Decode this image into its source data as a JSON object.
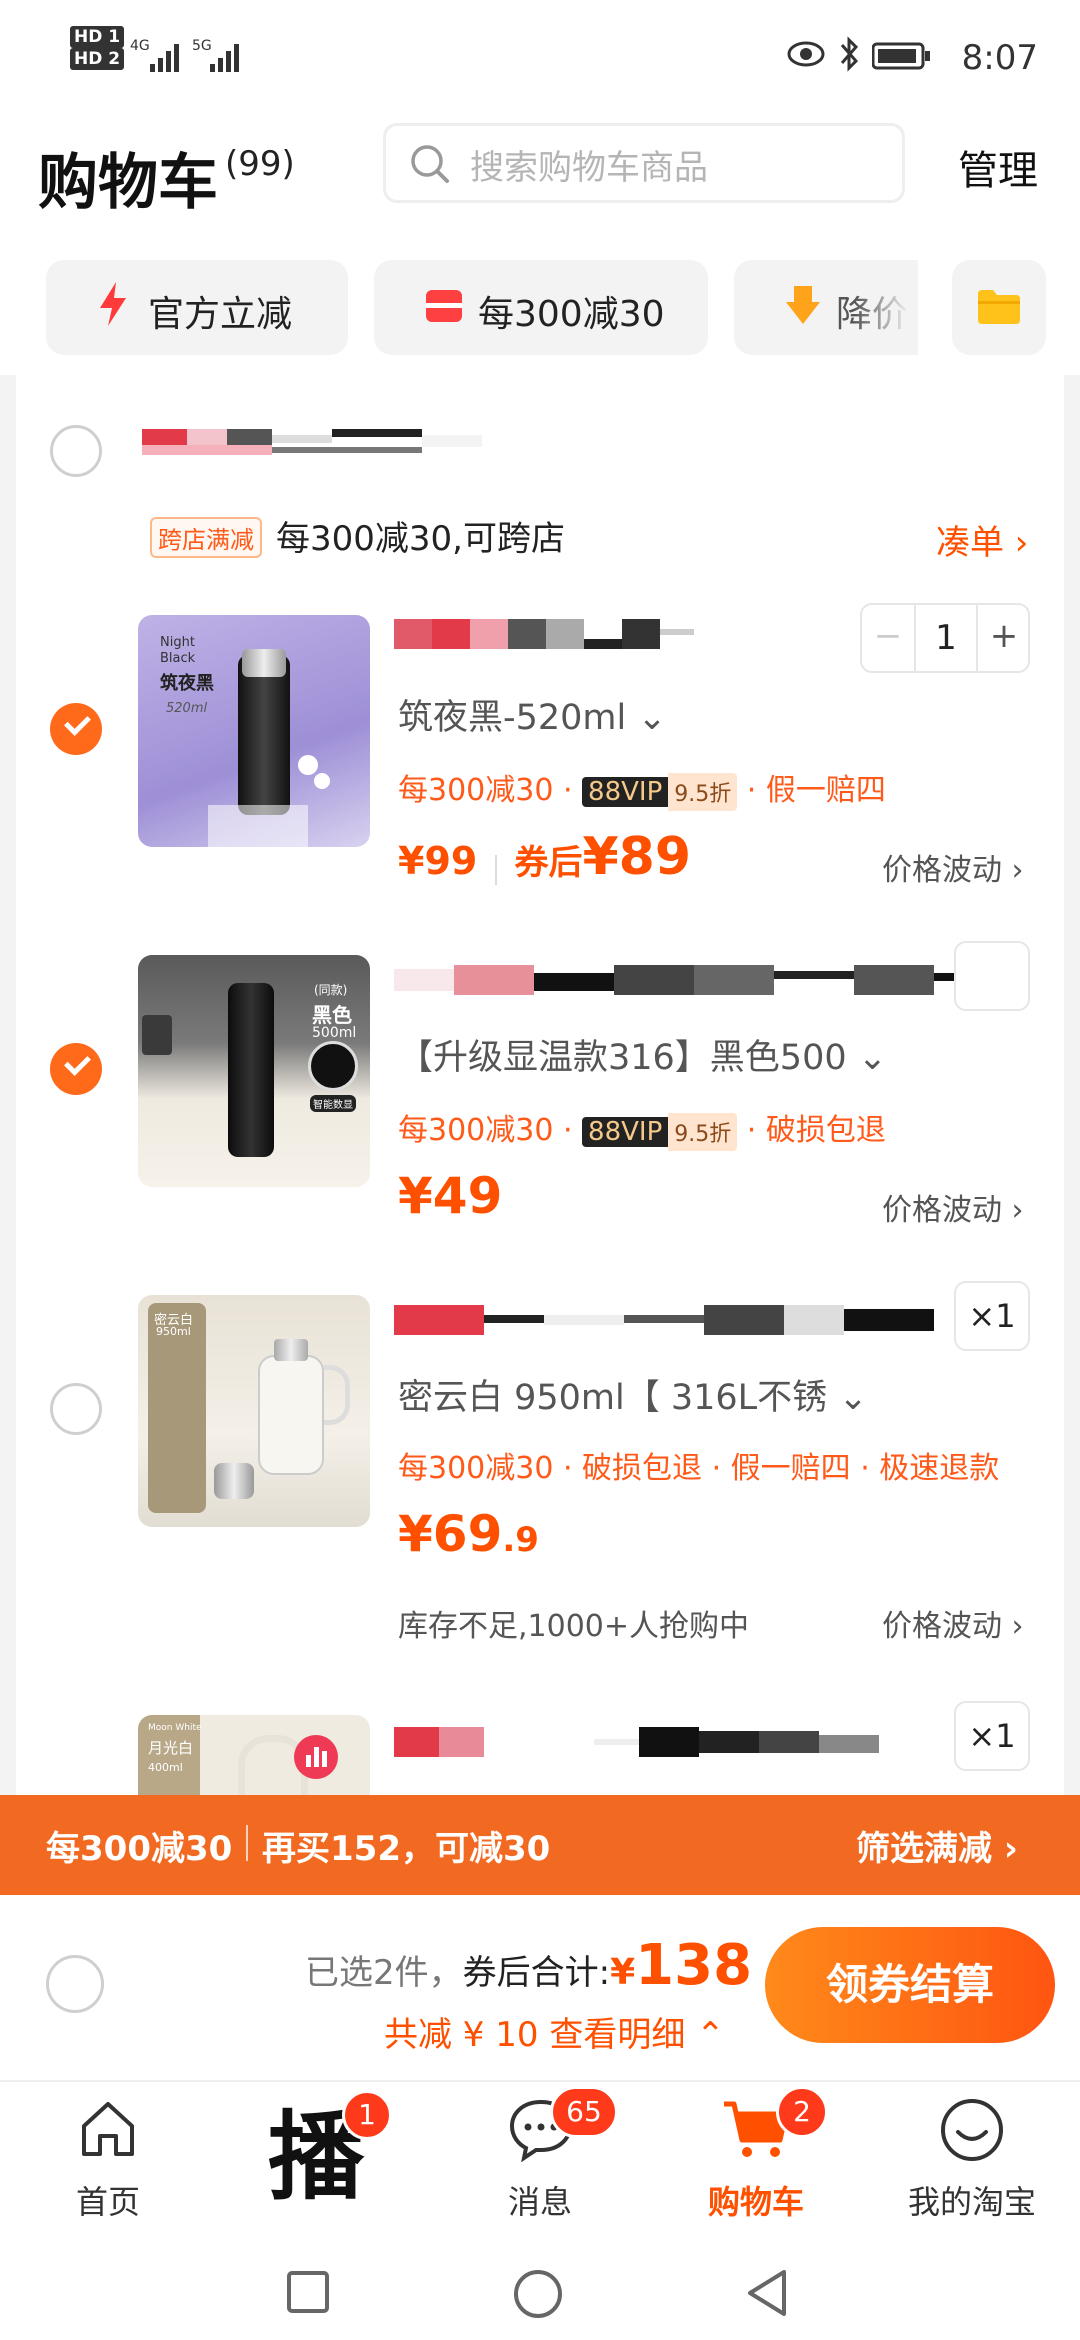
{
  "status_bar": {
    "hd1": "HD 1",
    "hd2": "HD 2",
    "net1": "4G",
    "net2": "5G",
    "time": "8:07"
  },
  "header": {
    "title": "购物车",
    "count": "(99)",
    "search_placeholder": "搜索购物车商品",
    "manage": "管理"
  },
  "chips": [
    "官方立减",
    "每300减30",
    "降价"
  ],
  "store": {
    "tag": "跨店满减",
    "promo_text": "每300减30,可跨店",
    "add_on": "凑单"
  },
  "items": [
    {
      "spec": "筑夜黑-520ml",
      "promo": "每300减30",
      "vip": "88VIP",
      "vip_discount": "9.5折",
      "service": "假一赔四",
      "price": "¥99",
      "coupon_label": "券后",
      "coupon_price": "¥89",
      "fluct": "价格波动",
      "qty": "1",
      "checked": true,
      "image_text": [
        "Night",
        "Black",
        "筑夜黑",
        "520ml"
      ]
    },
    {
      "spec": "【升级显温款316】黑色500",
      "promo": "每300减30",
      "vip": "88VIP",
      "vip_discount": "9.5折",
      "service": "破损包退",
      "price": "¥49",
      "fluct": "价格波动",
      "checked": true,
      "image_text": [
        "黑色",
        "500ml",
        "智能数显"
      ]
    },
    {
      "spec": "密云白 950ml【 316L不锈",
      "promo": "每300减30",
      "service": "破损包退",
      "service2": "假一赔四",
      "service3": "极速退款",
      "price_int": "¥69",
      "price_dec": ".9",
      "stock": "库存不足,1000+人抢购中",
      "fluct": "价格波动",
      "qty": "×1",
      "checked": false,
      "image_text": [
        "密云白",
        "950ml"
      ]
    },
    {
      "qty": "×1",
      "checked": false,
      "image_text": [
        "Moon White",
        "月光白",
        "400ml"
      ]
    }
  ],
  "promo_bar": {
    "left": "每300减30",
    "middle": "再买152，可减30",
    "right": "筛选满减"
  },
  "summary": {
    "selected": "已选2件，",
    "total_label": "券后合计:",
    "total_currency": "¥",
    "total": "138",
    "saved": "共减 ¥ 10",
    "detail": "查看明细",
    "checkout": "领券结算"
  },
  "tabbar": [
    {
      "label": "首页"
    },
    {
      "label": "播",
      "badge": "1"
    },
    {
      "label": "消息",
      "badge": "65"
    },
    {
      "label": "购物车",
      "badge": "2"
    },
    {
      "label": "我的淘宝"
    }
  ],
  "colors": {
    "accent": "#ff5000",
    "promo_bar": "#f26a22",
    "check_on": "#ff6a1a"
  }
}
